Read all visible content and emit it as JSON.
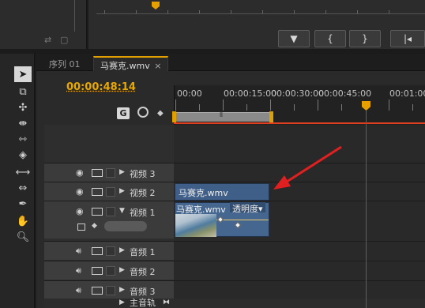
{
  "timecode": "00:00:48:14",
  "tabs": [
    {
      "label": "序列 01"
    },
    {
      "label": "马赛克.wmv",
      "close": "×"
    }
  ],
  "ruler": {
    "labels": [
      "00:00",
      "00:00:15:00",
      "00:00:30:00",
      "00:00:45:00",
      "00:01:00"
    ]
  },
  "tracks": {
    "video3": "视频 3",
    "video2": "视频 2",
    "video1": "视频 1",
    "audio1": "音频 1",
    "audio2": "音频 2",
    "audio3": "音频 3",
    "master": "主音轨"
  },
  "clips": {
    "video2_clip": "马赛克.wmv",
    "video1_clip": "马赛克.wmv",
    "opacity_menu": "透明度▾"
  },
  "colors": {
    "accent": "#e5a000",
    "playhead": "#d03020",
    "clip": "#45668f",
    "annotation_arrow": "#e02020"
  }
}
